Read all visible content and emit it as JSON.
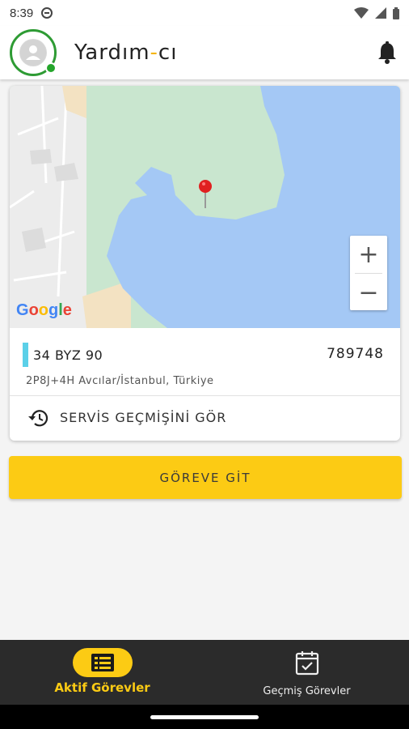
{
  "status_bar": {
    "time": "8:39"
  },
  "app_bar": {
    "brand_main": "Yardım",
    "brand_dash": "-",
    "brand_end": "cı"
  },
  "map": {
    "google_letters": [
      "G",
      "o",
      "o",
      "g",
      "l",
      "e"
    ],
    "google_colors": [
      "#4285F4",
      "#EA4335",
      "#FBBC05",
      "#4285F4",
      "#34A853",
      "#EA4335"
    ],
    "zoom_in": "+",
    "zoom_out": "−"
  },
  "task": {
    "plate": "34 BYZ 90",
    "order_no": "789748",
    "address": "2P8J+4H Avcılar/İstanbul, Türkiye",
    "history_label": "SERVİS GEÇMİŞİNİ GÖR"
  },
  "go_button": {
    "label": "GÖREVE GİT"
  },
  "bottom_nav": {
    "active_label": "Aktif Görevler",
    "past_label": "Geçmiş Görevler"
  },
  "colors": {
    "accent": "#fccb14",
    "online": "#24a52b",
    "plate_bar": "#5bd0e8",
    "water": "#a4c8f5",
    "park": "#c9e6cf"
  }
}
